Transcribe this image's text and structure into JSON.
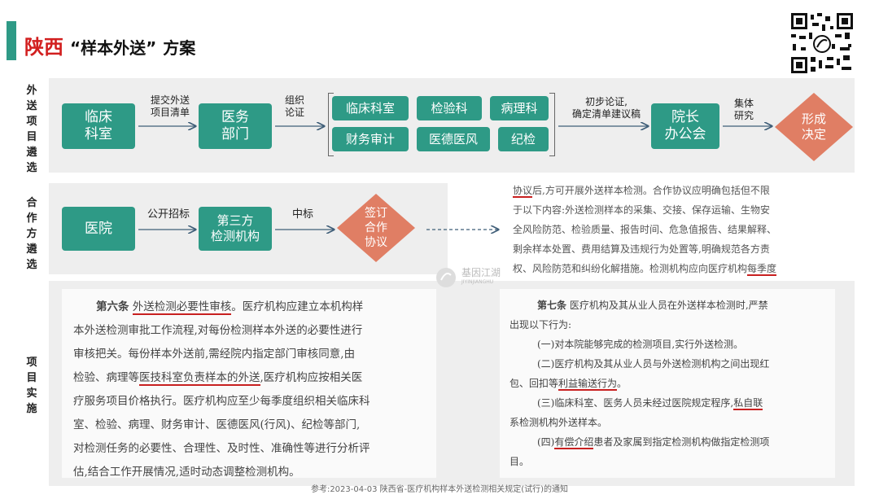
{
  "header": {
    "province": "陕西",
    "title_quoted": "“样本外送”",
    "title_rest": "方案"
  },
  "sections": {
    "s1": "外\n送\n项\n目\n遴\n选",
    "s2": "合\n作\n方\n遴\n选",
    "s3": "项\n目\n实\n施"
  },
  "row1": {
    "b_lc": "临床\n科室",
    "a1": "提交外送\n项目清单",
    "b_yw": "医务\n部门",
    "a2": "组织\n论证",
    "d1": "临床科室",
    "d2": "检验科",
    "d3": "病理科",
    "d4": "财务审计",
    "d5": "医德医风",
    "d6": "纪检",
    "a3": "初步论证,\n确定清单建议稿",
    "b_yz": "院长\n办公会",
    "a4": "集体\n研究",
    "diamond": "形成\n决定"
  },
  "row2": {
    "b_yy": "医院",
    "a1": "公开招标",
    "b_dsf": "第三方\n检测机构",
    "a2": "中标",
    "diamond": "签订\n合作\n协议"
  },
  "right_text": {
    "l1a": "协议",
    "l1b": "后,方可开展外送样本检测。合作协议应明确包括但不限",
    "l2": "于以下内容:外送检测样本的采集、交接、保存运输、生物安",
    "l3": "全风险防范、检验质量、报告时间、危急值报告、结果解释、",
    "l4": "剩余样本处置、费用结算及违规行为处置等,明确规范各方责",
    "l5a": "权、风险防范和纠纷化解措施。检测机构应向医疗机构",
    "l5b": "每季度"
  },
  "art6": {
    "l1a": "第六条",
    "l1b": "外送检测必要性审核",
    "l1c": "。医疗机构应建立本机构样",
    "l2": "本外送检测审批工作流程,对每份检测样本外送的必要性进行",
    "l3": "审核把关。每份样本外送前,需经院内指定部门审核同意,由",
    "l4a": "检验、病理等",
    "l4b": "医技科室负责样本的外送",
    "l4c": ",医疗机构应按相关医",
    "l5": "疗服务项目价格执行。医疗机构应至少每季度组织相关临床科",
    "l6": "室、检验、病理、财务审计、医德医风(行风)、纪检等部门,",
    "l7": "对检测任务的必要性、合理性、及时性、准确性等进行分析评",
    "l8": "估,结合工作开展情况,适时动态调整检测机构。"
  },
  "art7": {
    "l1a": "第七条",
    "l1b": "医疗机构及其从业人员在外送样本检测时,严禁",
    "l2": "出现以下行为:",
    "l3": "(一)对本院能够完成的检测项目,实行外送检测。",
    "l4": "(二)医疗机构及其从业人员与外送检测机构之间出现红",
    "l5a": "包、回扣等",
    "l5b": "利益输送行为",
    "l5c": "。",
    "l6a": "(三)临床科室、医务人员未经过医院规定程序,",
    "l6b": "私自联",
    "l7": "系检测机构外送样本。",
    "l8a": "(四)",
    "l8b": "有偿介绍",
    "l8c": "患者及家属到指定检测机构做指定检测项",
    "l9": "目。"
  },
  "watermark": {
    "cn": "基因江湖",
    "en": "JIYINJIANGHU"
  },
  "reference": "参考:2023-04-03 陕西省-医疗机构样本外送检测相关规定(试行)的通知",
  "colors": {
    "teal": "#2e9a86",
    "salmon": "#e07e64",
    "red": "#d21f1f"
  }
}
